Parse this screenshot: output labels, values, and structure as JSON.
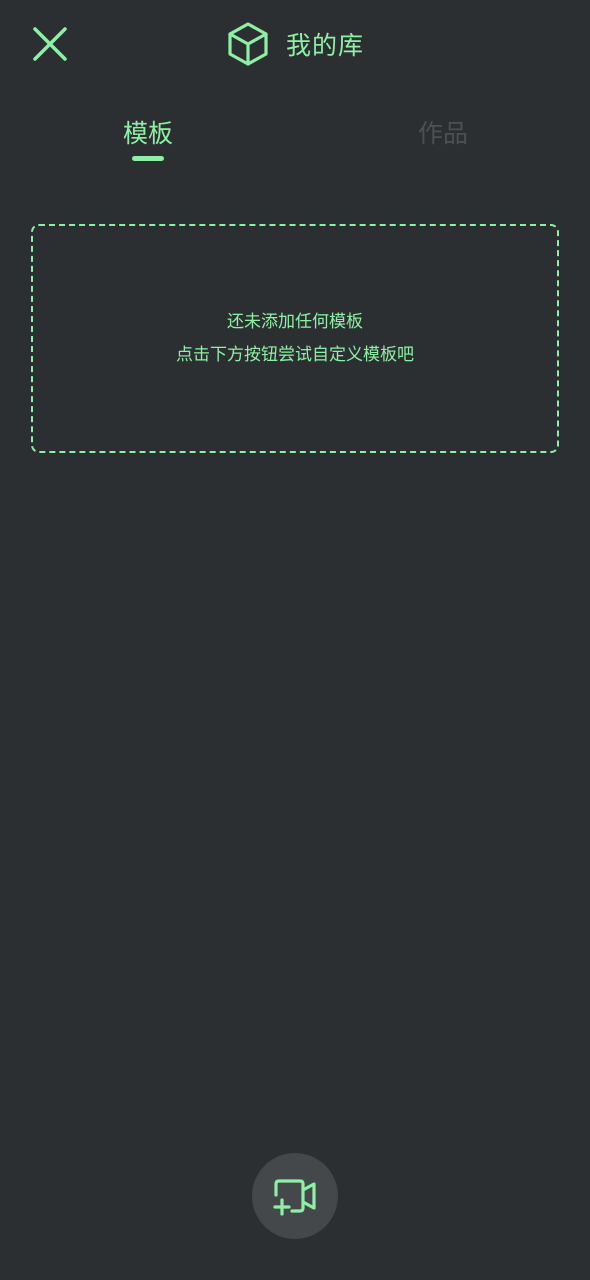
{
  "header": {
    "title": "我的库",
    "title_icon": "cube-icon",
    "close_icon": "close-icon"
  },
  "tabs": [
    {
      "label": "模板",
      "active": true
    },
    {
      "label": "作品",
      "active": false
    }
  ],
  "empty_state": {
    "line1": "还未添加任何模板",
    "line2": "点击下方按钮尝试自定义模板吧"
  },
  "fab": {
    "icon": "add-video-icon"
  },
  "colors": {
    "background": "#2c2f32",
    "accent": "#8ef0a4",
    "inactive_tab": "#4a5054",
    "fab_background": "#44484b"
  }
}
